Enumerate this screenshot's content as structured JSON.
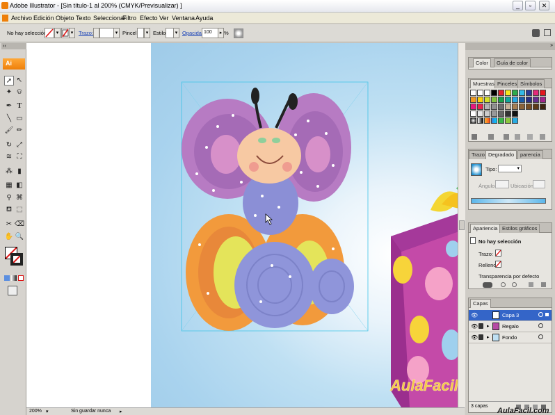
{
  "window": {
    "title": "Adobe Illustrator - [Sin título-1 al 200% (CMYK/Previsualizar) ]",
    "minimize": "_",
    "restore": "▫",
    "close": "✕"
  },
  "menu": [
    "Archivo",
    "Edición",
    "Objeto",
    "Texto",
    "Seleccionar",
    "Filtro",
    "Efecto",
    "Ver",
    "Ventana",
    "Ayuda"
  ],
  "control": {
    "selection": "No hay selección",
    "stroke_label": "Trazo:",
    "brush_label": "Pincel:",
    "style_label": "Estilo:",
    "opacity_label": "Opacidad:",
    "opacity_value": "100",
    "percent": "%"
  },
  "toolbox": {
    "logo": "Ai"
  },
  "status": {
    "zoom": "200%",
    "info": "Sin guardar nunca"
  },
  "panels": {
    "color_tabs": [
      "Color",
      "Guía de color"
    ],
    "swatch_tabs": [
      "Muestras",
      "Pinceles",
      "Símbolos"
    ],
    "gradient_tabs": [
      "Trazo",
      "Degradado",
      "parencia"
    ],
    "gradient": {
      "type_label": "Tipo:",
      "angle_label": "Ángulo",
      "location_label": "Ubicación"
    },
    "appearance_tabs": [
      "Apariencia",
      "Estilos gráficos"
    ],
    "appearance": {
      "header": "No hay selección",
      "stroke": "Trazo:",
      "fill": "Relleno:",
      "transparency": "Transparencia por defecto"
    },
    "layers_tab": "Capas",
    "layers": [
      "Capa 3",
      "Regalo",
      "Fondo"
    ],
    "layers_count": "3 capas"
  },
  "watermark": {
    "main": "AulaFacil.com",
    "corner": "AulaFacil.com"
  },
  "colors": {
    "accent": "#3465c8",
    "ai_orange": "#ee7f0a",
    "canvas_blue": "#a9d3ee",
    "watermark_yellow": "#f6c94a"
  }
}
